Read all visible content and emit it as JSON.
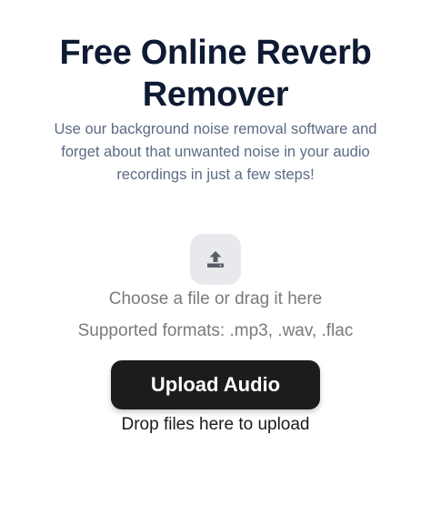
{
  "header": {
    "title_line1": "Free Online Reverb",
    "title_line2": "Remover",
    "subtitle": "Use our background noise removal software and forget about that unwanted noise in your audio recordings in just a few steps!"
  },
  "upload": {
    "icon": "upload-icon",
    "choose_text": "Choose a file or drag it here",
    "formats_text": "Supported formats: .mp3, .wav, .flac",
    "button_label": "Upload Audio",
    "drop_text": "Drop files here to upload"
  },
  "colors": {
    "title": "#0f1a33",
    "subtitle": "#5c6b86",
    "muted_text": "#7a7a7a",
    "button_bg": "#1c1c1e",
    "button_text": "#ffffff",
    "icon_box_bg": "#e8e9ec",
    "icon": "#5a5d66"
  }
}
